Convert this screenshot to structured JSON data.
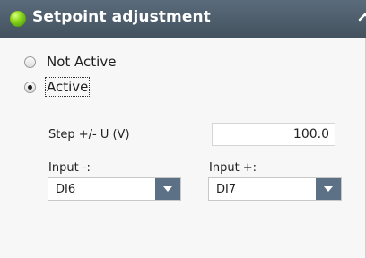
{
  "panel": {
    "title": "Setpoint adjustment",
    "icons": {
      "status": "green-status-icon",
      "collapse": "chevron-up-icon",
      "dropdown": "chevron-down-icon"
    }
  },
  "mode": {
    "options": [
      {
        "label": "Not Active",
        "selected": false
      },
      {
        "label": "Active",
        "selected": true
      }
    ]
  },
  "step": {
    "label": "Step +/- U (V)",
    "value": "100.0"
  },
  "input_minus": {
    "label": "Input -:",
    "value": "DI6"
  },
  "input_plus": {
    "label": "Input +:",
    "value": "DI7"
  }
}
